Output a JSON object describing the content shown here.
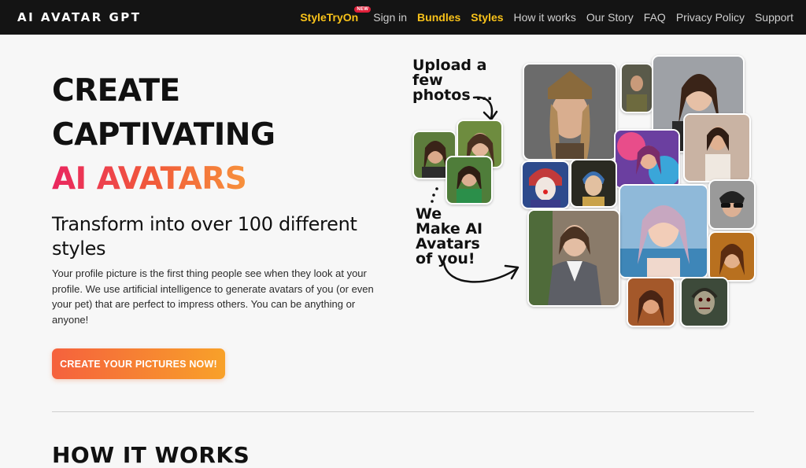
{
  "brand": {
    "name": "AI AVATAR GPT"
  },
  "nav": {
    "items": [
      {
        "label": "StyleTryOn",
        "badge": "NEW",
        "highlight": true
      },
      {
        "label": "Sign in",
        "highlight": false
      },
      {
        "label": "Bundles",
        "highlight": true
      },
      {
        "label": "Styles",
        "highlight": true
      },
      {
        "label": "How it works",
        "highlight": false
      },
      {
        "label": "Our Story",
        "highlight": false
      },
      {
        "label": "FAQ",
        "highlight": false
      },
      {
        "label": "Privacy Policy",
        "highlight": false
      },
      {
        "label": "Support",
        "highlight": false
      }
    ]
  },
  "hero": {
    "title_line1": "CREATE",
    "title_line2": "CAPTIVATING",
    "title_line3": "AI AVATARS",
    "subheading": "Transform into over 100 different styles",
    "description": "Your profile picture is the first thing people see when they look at your profile. We use artificial intelligence to generate avatars of you (or even your pet) that are perfect to impress others. You can be anything or anyone!",
    "cta_label": "CREATE YOUR PICTURES NOW!"
  },
  "collage": {
    "upload_lines": [
      "Upload a",
      "few",
      "photos ..."
    ],
    "make_lines": [
      "We",
      "Make AI",
      "Avatars",
      "of you!"
    ]
  },
  "section": {
    "heading": "HOW IT WORKS"
  },
  "colors": {
    "nav_bg": "#141414",
    "nav_highlight": "#f8c21a",
    "accent_gradient_start": "#e9265f",
    "accent_gradient_end": "#f9a23c",
    "cta_start": "#f5613d",
    "cta_end": "#f8a129"
  }
}
